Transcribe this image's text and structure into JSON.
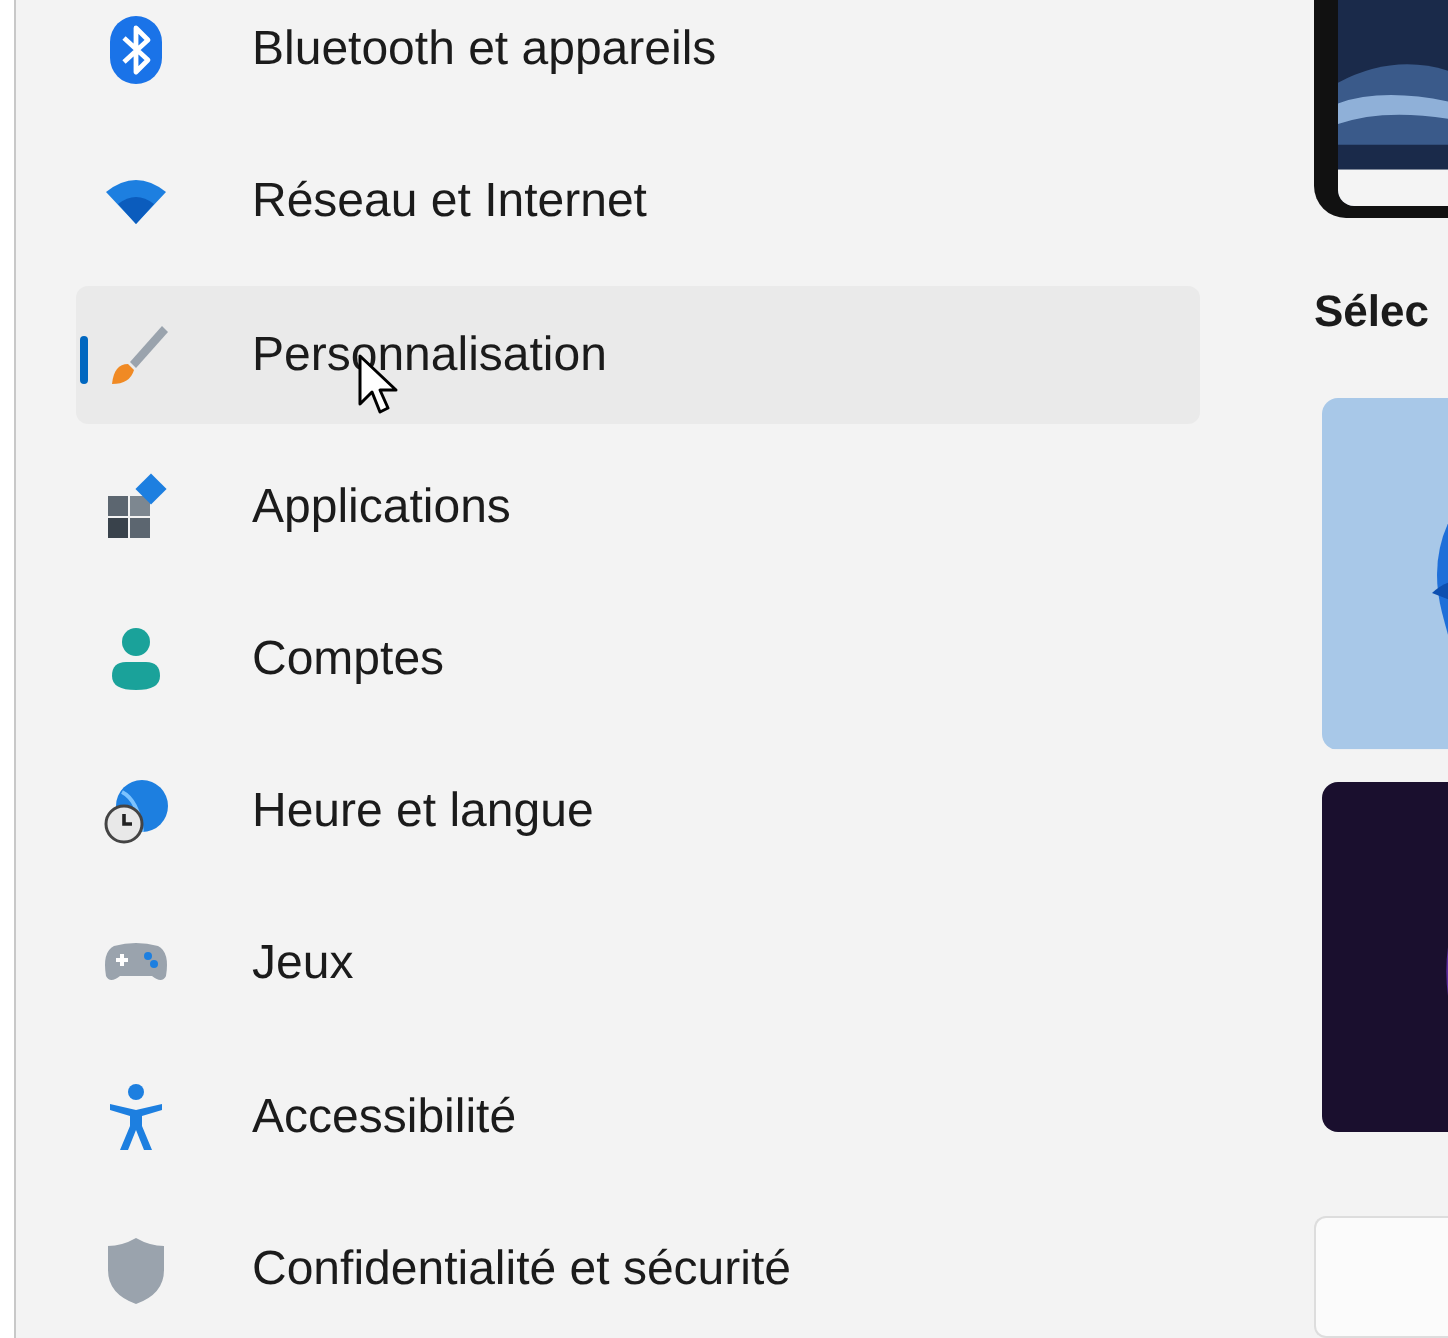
{
  "nav_items": [
    {
      "label": "Bluetooth et appareils",
      "selected": false
    },
    {
      "label": "Réseau et Internet",
      "selected": false
    },
    {
      "label": "Personnalisation",
      "selected": true
    },
    {
      "label": "Applications",
      "selected": false
    },
    {
      "label": "Comptes",
      "selected": false
    },
    {
      "label": "Heure et langue",
      "selected": false
    },
    {
      "label": "Jeux",
      "selected": false
    },
    {
      "label": "Accessibilité",
      "selected": false
    },
    {
      "label": "Confidentialité et sécurité",
      "selected": false
    }
  ],
  "section_heading": "Sélec"
}
